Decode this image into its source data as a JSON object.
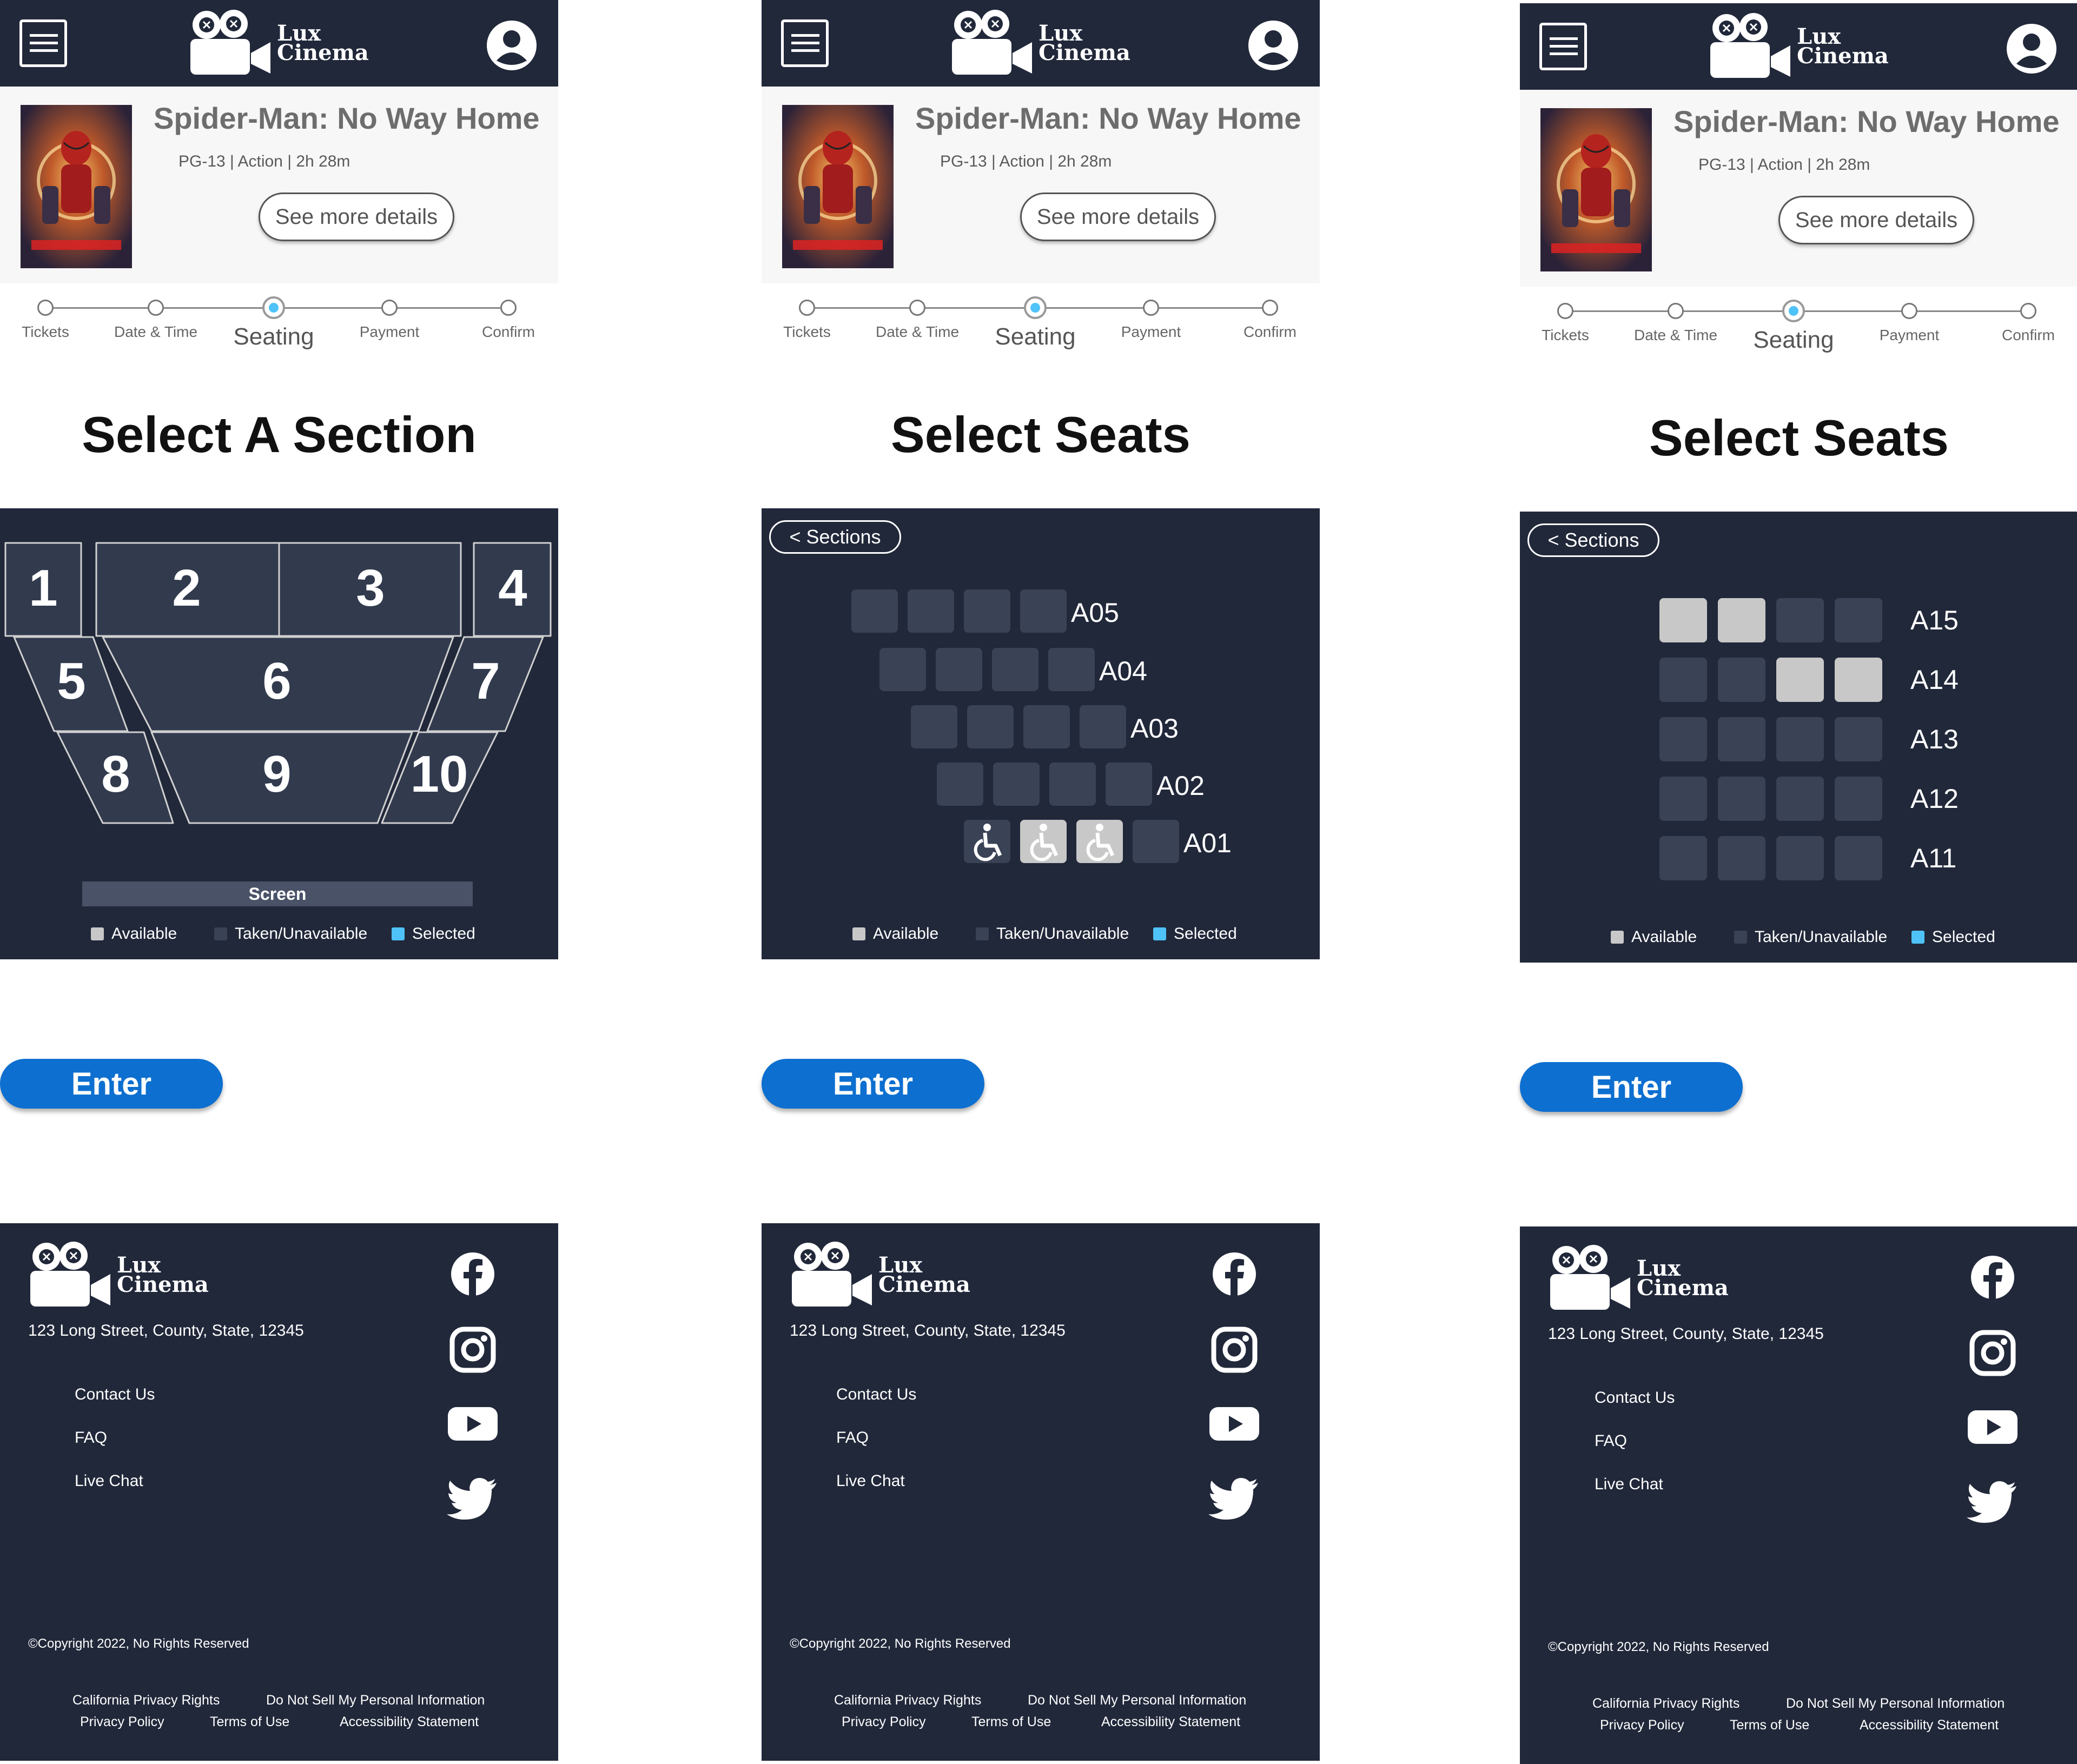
{
  "brand": {
    "line1": "Lux",
    "line2": "Cinema"
  },
  "movie": {
    "title": "Spider-Man: No Way Home",
    "meta": "PG-13 | Action | 2h 28m",
    "details_button": "See more details"
  },
  "steps": [
    "Tickets",
    "Date & Time",
    "Seating",
    "Payment",
    "Confirm"
  ],
  "active_step": "Seating",
  "screens": [
    {
      "heading": "Select A Section",
      "enter": "Enter"
    },
    {
      "heading": "Select Seats",
      "back": "< Sections",
      "enter": "Enter",
      "rows": [
        "A05",
        "A04",
        "A03",
        "A02",
        "A01"
      ]
    },
    {
      "heading": "Select Seats",
      "back": "< Sections",
      "enter": "Enter",
      "rows": [
        "A15",
        "A14",
        "A13",
        "A12",
        "A11"
      ]
    }
  ],
  "section_map": {
    "sections": [
      "1",
      "2",
      "3",
      "4",
      "5",
      "6",
      "7",
      "8",
      "9",
      "10"
    ],
    "screen_label": "Screen"
  },
  "legend": {
    "available": "Available",
    "taken": "Taken/Unavailable",
    "selected": "Selected"
  },
  "colors": {
    "navy": "#21283a",
    "accent": "#0d6fd0",
    "selected": "#4fc3f7",
    "available": "#c8c8c8",
    "taken": "#3a4256"
  },
  "footer": {
    "address": "123 Long Street, County, State, 12345",
    "links": [
      "Contact Us",
      "FAQ",
      "Live Chat"
    ],
    "social": [
      "facebook-icon",
      "instagram-icon",
      "youtube-icon",
      "twitter-icon"
    ],
    "copyright": "©Copyright 2022, No Rights Reserved",
    "legal": [
      "California Privacy Rights",
      "Do Not Sell My Personal Information",
      "Privacy Policy",
      "Terms of Use",
      "Accessibility Statement"
    ]
  }
}
